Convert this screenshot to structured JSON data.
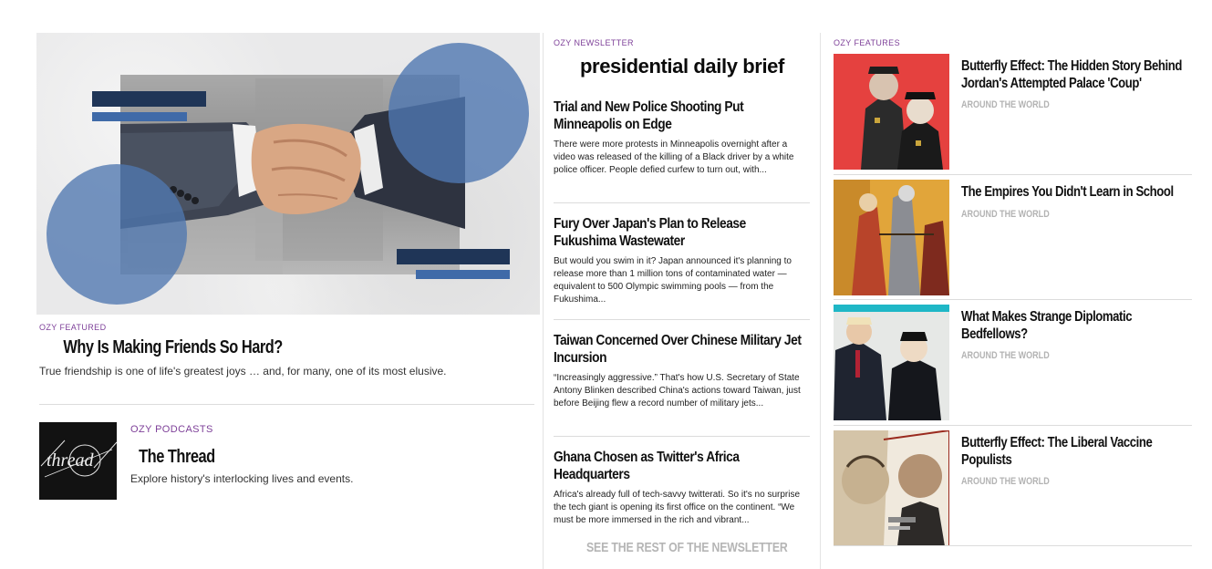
{
  "featured": {
    "kicker": "OZY FEATURED",
    "title": "Why Is Making Friends So Hard?",
    "description": "True friendship is one of life's greatest joys … and, for many, one of its most elusive.",
    "image_icon": "handshake-illustration"
  },
  "podcast": {
    "kicker": "OZY PODCASTS",
    "title": "The Thread",
    "description": "Explore history's interlocking lives and events.",
    "thumb_text": "thread"
  },
  "newsletter": {
    "kicker": "OZY NEWSLETTER",
    "logo_text": "presidential daily brief",
    "items": [
      {
        "title": "Trial and New Police Shooting Put Minneapolis on Edge",
        "text": "There were more protests in Minneapolis overnight after a video was released of the killing of a Black driver by a white police officer. People defied curfew to turn out, with..."
      },
      {
        "title": "Fury Over Japan's Plan to Release Fukushima Wastewater",
        "text": "But would you swim in it? Japan announced it's planning to release more than 1 million tons of contaminated water — equivalent to 500 Olympic swimming pools — from the Fukushima..."
      },
      {
        "title": "Taiwan Concerned Over Chinese Military Jet Incursion",
        "text": "“Increasingly aggressive.” That's how U.S. Secretary of State Antony Blinken described China's actions toward Taiwan, just before Beijing flew a record number of military jets..."
      },
      {
        "title": "Ghana Chosen as Twitter's Africa Headquarters",
        "text": "Africa's already full of tech-savvy twitterati. So it's no surprise the tech giant is opening its first office on the continent. “We must be more immersed in the rich and vibrant..."
      }
    ],
    "see_rest": "SEE THE REST OF THE NEWSLETTER"
  },
  "features": {
    "kicker": "OZY FEATURES",
    "items": [
      {
        "title": "Butterfly Effect: The Hidden Story Behind Jordan's Attempted Palace 'Coup'",
        "section": "AROUND THE WORLD"
      },
      {
        "title": "The Empires You Didn't Learn in School",
        "section": "AROUND THE WORLD"
      },
      {
        "title": "What Makes Strange Diplomatic Bedfellows?",
        "section": "AROUND THE WORLD"
      },
      {
        "title": "Butterfly Effect: The Liberal Vaccine Populists",
        "section": "AROUND THE WORLD"
      }
    ]
  },
  "colors": {
    "accent_purple": "#7d3f98",
    "circle_blue": "#4f77b0",
    "bar_navy": "#1f3557",
    "bar_blue": "#3f6aa8",
    "logo_underline": "#57c3e0"
  }
}
